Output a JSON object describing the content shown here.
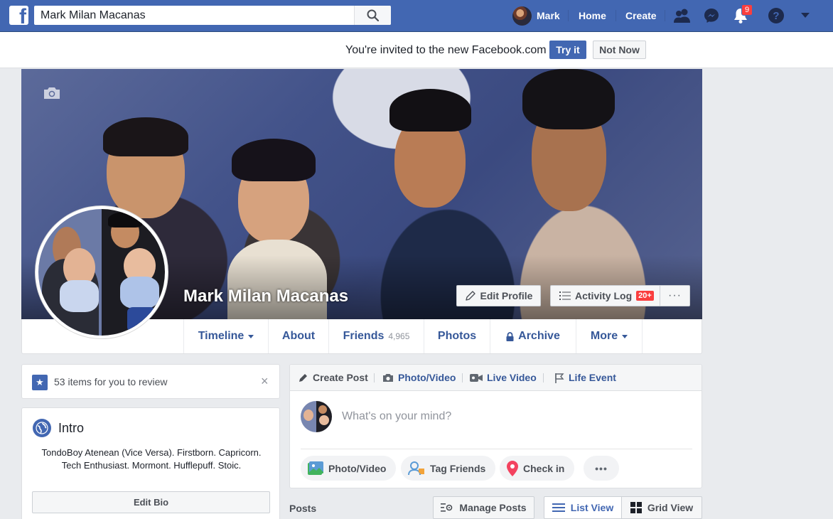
{
  "topbar": {
    "search_value": "Mark Milan Macanas",
    "user_name": "Mark",
    "home_label": "Home",
    "create_label": "Create",
    "notifications_count": "9"
  },
  "invite": {
    "text": "You're invited to the new Facebook.com",
    "try_label": "Try it",
    "not_now_label": "Not Now"
  },
  "profile": {
    "name": "Mark Milan Macanas",
    "edit_profile_label": "Edit Profile",
    "activity_log_label": "Activity Log",
    "activity_log_badge": "20+",
    "more_cover_label": "···"
  },
  "tabs": [
    {
      "label": "Timeline"
    },
    {
      "label": "About"
    },
    {
      "label": "Friends",
      "count": "4,965"
    },
    {
      "label": "Photos"
    },
    {
      "label": "Archive"
    },
    {
      "label": "More"
    }
  ],
  "review": {
    "text": "53 items for you to review",
    "close_label": "×"
  },
  "intro": {
    "title": "Intro",
    "bio": "TondoBoy Atenean (Vice Versa). Firstborn. Capricorn. Tech Enthusiast. Mormont. Hufflepuff. Stoic.",
    "edit_bio_label": "Edit Bio"
  },
  "composer": {
    "tabs": [
      "Create Post",
      "Photo/Video",
      "Live Video",
      "Life Event"
    ],
    "placeholder": "What's on your mind?",
    "actions": [
      "Photo/Video",
      "Tag Friends",
      "Check in"
    ],
    "more_label": "•••"
  },
  "posts": {
    "label": "Posts",
    "manage_label": "Manage Posts",
    "list_view_label": "List View",
    "grid_view_label": "Grid View"
  },
  "colors": {
    "brand_blue": "#4267b2",
    "link_blue": "#365899",
    "badge_red": "#fa3e3e",
    "background": "#e9ebee"
  }
}
